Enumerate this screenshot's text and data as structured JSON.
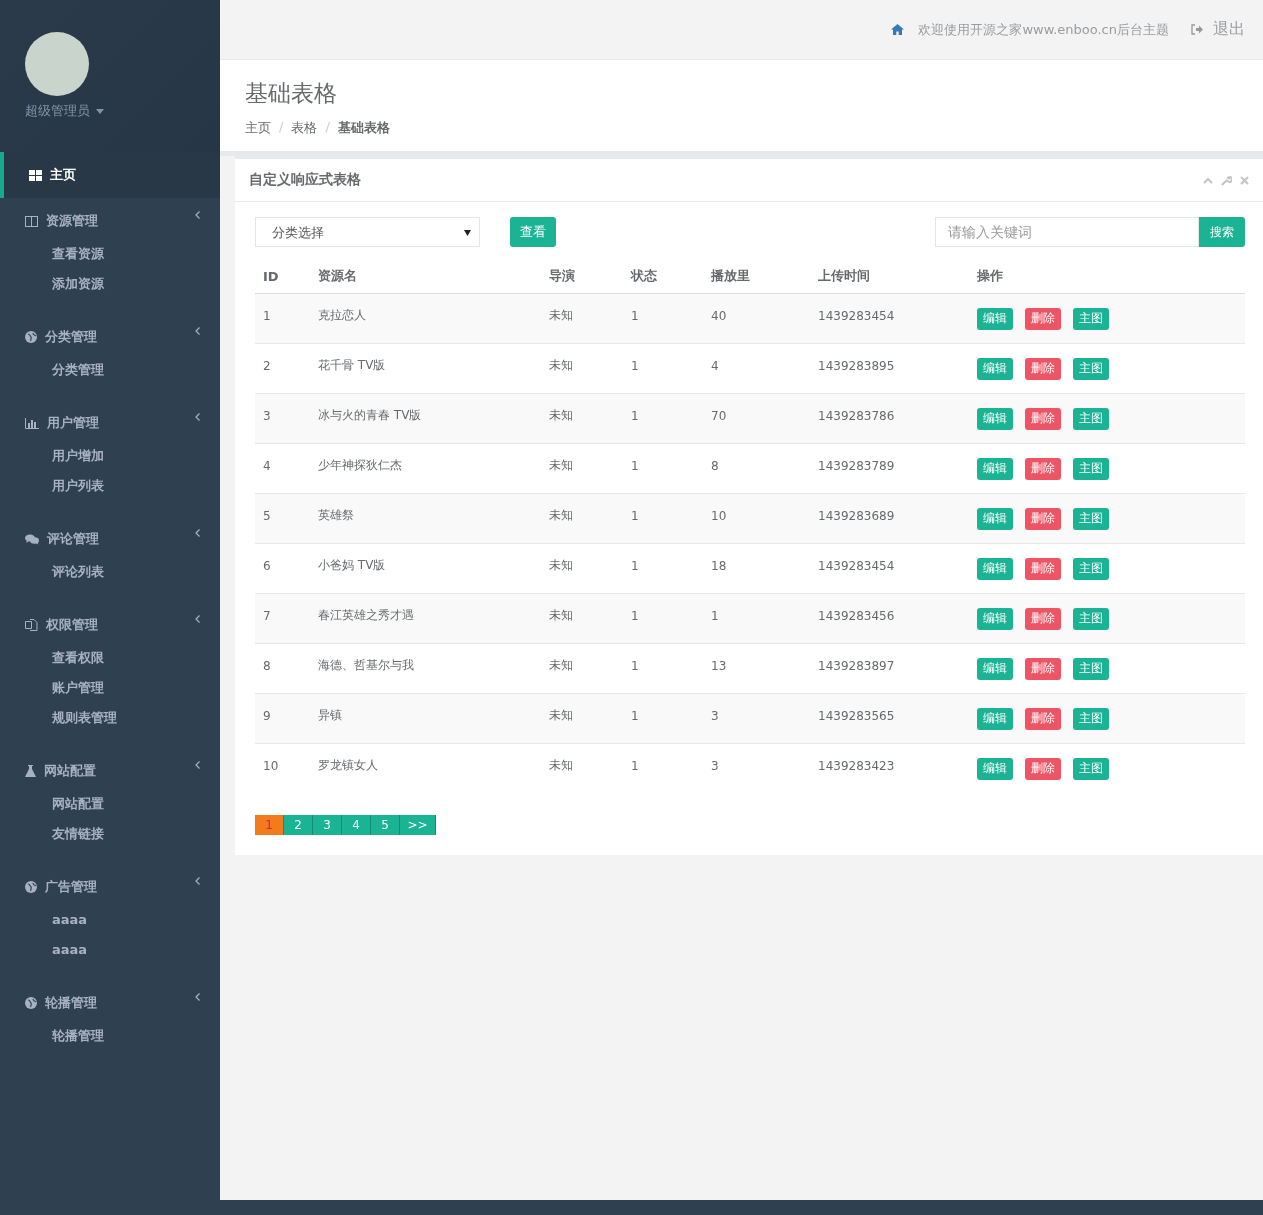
{
  "sidebar": {
    "user": {
      "name": "超级管理员"
    },
    "menu": [
      {
        "label": "主页",
        "selected": true
      },
      {
        "label": "资源管理",
        "selected": false,
        "children": [
          {
            "label": "查看资源"
          },
          {
            "label": "添加资源"
          }
        ]
      },
      {
        "label": "分类管理",
        "selected": false,
        "children": [
          {
            "label": "分类管理"
          }
        ]
      },
      {
        "label": "用户管理",
        "selected": false,
        "children": [
          {
            "label": "用户增加"
          },
          {
            "label": "用户列表"
          }
        ]
      },
      {
        "label": "评论管理",
        "selected": false,
        "children": [
          {
            "label": "评论列表"
          }
        ]
      },
      {
        "label": "权限管理",
        "selected": false,
        "children": [
          {
            "label": "查看权限"
          },
          {
            "label": "账户管理"
          },
          {
            "label": "规则表管理"
          }
        ]
      },
      {
        "label": "网站配置",
        "selected": false,
        "children": [
          {
            "label": "网站配置"
          },
          {
            "label": "友情链接"
          }
        ]
      },
      {
        "label": "广告管理",
        "selected": false,
        "children": [
          {
            "label": "aaaa"
          },
          {
            "label": "aaaa"
          }
        ]
      },
      {
        "label": "轮播管理",
        "selected": false,
        "children": [
          {
            "label": "轮播管理"
          }
        ]
      }
    ]
  },
  "topbar": {
    "welcome": "欢迎使用开源之家www.enboo.cn后台主题",
    "logout": "退出"
  },
  "page_heading": {
    "title": "基础表格",
    "breadcrumb": [
      {
        "label": "主页",
        "selected": false
      },
      {
        "label": "表格",
        "selected": false
      },
      {
        "label": "基础表格",
        "selected": true
      }
    ],
    "separator": "/"
  },
  "card": {
    "title": "自定义响应式表格",
    "filter": {
      "select": "分类选择",
      "view_button": "查看"
    },
    "search": {
      "placeholder": "请输入关键词",
      "button": "搜索"
    },
    "table": {
      "columns": [
        "ID",
        "资源名",
        "导演",
        "状态",
        "播放里",
        "上传时间",
        "操作"
      ],
      "rows": [
        {
          "cells": [
            "1",
            "克拉恋人",
            "未知",
            "1",
            "40",
            "1439283454"
          ],
          "actions": [
            {
              "label": "编辑",
              "kind": "primary"
            },
            {
              "label": "删除",
              "kind": "danger"
            },
            {
              "label": "主图",
              "kind": "primary"
            }
          ]
        },
        {
          "cells": [
            "2",
            "花千骨 TV版",
            "未知",
            "1",
            "4",
            "1439283895"
          ],
          "actions": [
            {
              "label": "编辑",
              "kind": "primary"
            },
            {
              "label": "删除",
              "kind": "danger"
            },
            {
              "label": "主图",
              "kind": "primary"
            }
          ]
        },
        {
          "cells": [
            "3",
            "冰与火的青春 TV版",
            "未知",
            "1",
            "70",
            "1439283786"
          ],
          "actions": [
            {
              "label": "编辑",
              "kind": "primary"
            },
            {
              "label": "删除",
              "kind": "danger"
            },
            {
              "label": "主图",
              "kind": "primary"
            }
          ]
        },
        {
          "cells": [
            "4",
            "少年神探狄仁杰",
            "未知",
            "1",
            "8",
            "1439283789"
          ],
          "actions": [
            {
              "label": "编辑",
              "kind": "primary"
            },
            {
              "label": "删除",
              "kind": "danger"
            },
            {
              "label": "主图",
              "kind": "primary"
            }
          ]
        },
        {
          "cells": [
            "5",
            "英雄祭",
            "未知",
            "1",
            "10",
            "1439283689"
          ],
          "actions": [
            {
              "label": "编辑",
              "kind": "primary"
            },
            {
              "label": "删除",
              "kind": "danger"
            },
            {
              "label": "主图",
              "kind": "primary"
            }
          ]
        },
        {
          "cells": [
            "6",
            "小爸妈 TV版",
            "未知",
            "1",
            "18",
            "1439283454"
          ],
          "actions": [
            {
              "label": "编辑",
              "kind": "primary"
            },
            {
              "label": "删除",
              "kind": "danger"
            },
            {
              "label": "主图",
              "kind": "primary"
            }
          ]
        },
        {
          "cells": [
            "7",
            "春江英雄之秀才遇",
            "未知",
            "1",
            "1",
            "1439283456"
          ],
          "actions": [
            {
              "label": "编辑",
              "kind": "primary"
            },
            {
              "label": "删除",
              "kind": "danger"
            },
            {
              "label": "主图",
              "kind": "primary"
            }
          ]
        },
        {
          "cells": [
            "8",
            "海德、哲基尔与我",
            "未知",
            "1",
            "13",
            "1439283897"
          ],
          "actions": [
            {
              "label": "编辑",
              "kind": "primary"
            },
            {
              "label": "删除",
              "kind": "danger"
            },
            {
              "label": "主图",
              "kind": "primary"
            }
          ]
        },
        {
          "cells": [
            "9",
            "异镇",
            "未知",
            "1",
            "3",
            "1439283565"
          ],
          "actions": [
            {
              "label": "编辑",
              "kind": "primary"
            },
            {
              "label": "删除",
              "kind": "danger"
            },
            {
              "label": "主图",
              "kind": "primary"
            }
          ]
        },
        {
          "cells": [
            "10",
            "罗龙镇女人",
            "未知",
            "1",
            "3",
            "1439283423"
          ],
          "actions": [
            {
              "label": "编辑",
              "kind": "primary"
            },
            {
              "label": "删除",
              "kind": "danger"
            },
            {
              "label": "主图",
              "kind": "primary"
            }
          ]
        }
      ]
    },
    "pagination": [
      {
        "label": "1",
        "selected": true
      },
      {
        "label": "2",
        "selected": false
      },
      {
        "label": "3",
        "selected": false
      },
      {
        "label": "4",
        "selected": false
      },
      {
        "label": "5",
        "selected": false
      },
      {
        "label": ">>",
        "selected": false
      }
    ]
  }
}
